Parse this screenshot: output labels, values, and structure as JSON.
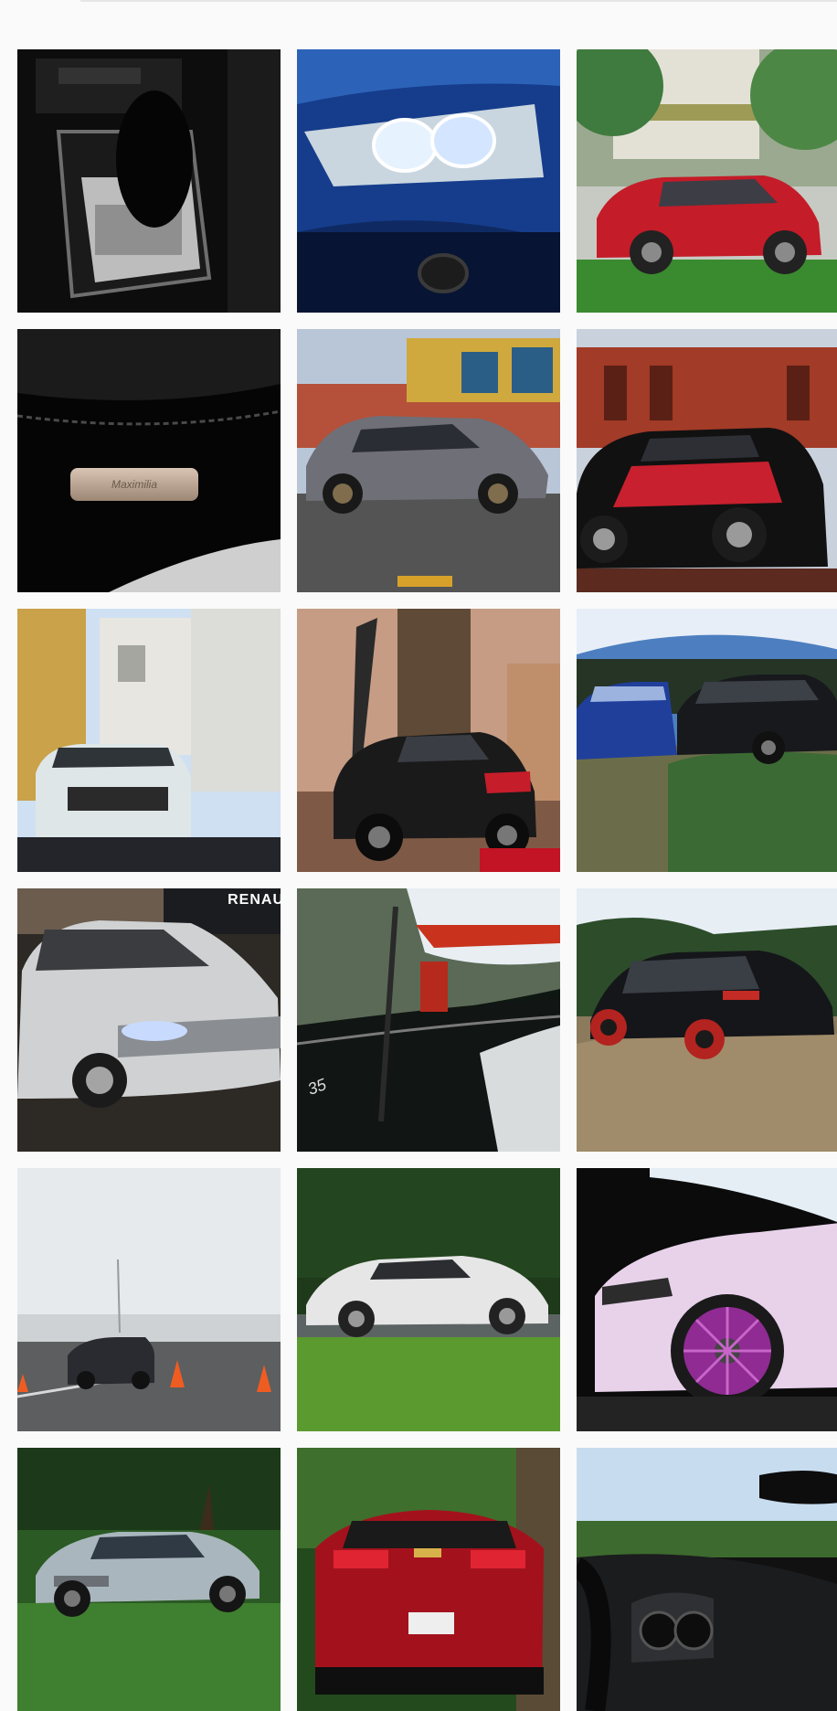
{
  "gallery": {
    "tiles": [
      {
        "name": "gear-shift-console-photo",
        "icon": "car-interior"
      },
      {
        "name": "blue-headlight-photo",
        "icon": "car-headlight"
      },
      {
        "name": "red-suv-photo",
        "icon": "car"
      },
      {
        "name": "leather-seat-badge-photo",
        "icon": "seat",
        "plate_text": "Maximilia"
      },
      {
        "name": "gray-hatchback-photo",
        "icon": "car"
      },
      {
        "name": "red-black-smart-photo",
        "icon": "car"
      },
      {
        "name": "white-smart-church-photo",
        "icon": "car"
      },
      {
        "name": "black-smart-red-carpet-photo",
        "icon": "car"
      },
      {
        "name": "blue-and-black-smart-photo",
        "icon": "car"
      },
      {
        "name": "white-renault-sedan-photo",
        "icon": "car",
        "badge_text": "RENAU"
      },
      {
        "name": "car-door-reflection-photo",
        "icon": "car-door",
        "decal_text": "35"
      },
      {
        "name": "black-hatchback-red-wheels-photo",
        "icon": "car"
      },
      {
        "name": "test-track-cones-photo",
        "icon": "car"
      },
      {
        "name": "white-coupe-lawn-photo",
        "icon": "car"
      },
      {
        "name": "purple-wheel-sedan-photo",
        "icon": "car-wheel"
      },
      {
        "name": "silver-audi-park-photo",
        "icon": "car"
      },
      {
        "name": "red-chevrolet-rear-photo",
        "icon": "car"
      },
      {
        "name": "dashboard-view-photo",
        "icon": "car-interior"
      }
    ]
  },
  "colors": {
    "background": "#fafafa",
    "divider": "#e6e6e6"
  }
}
